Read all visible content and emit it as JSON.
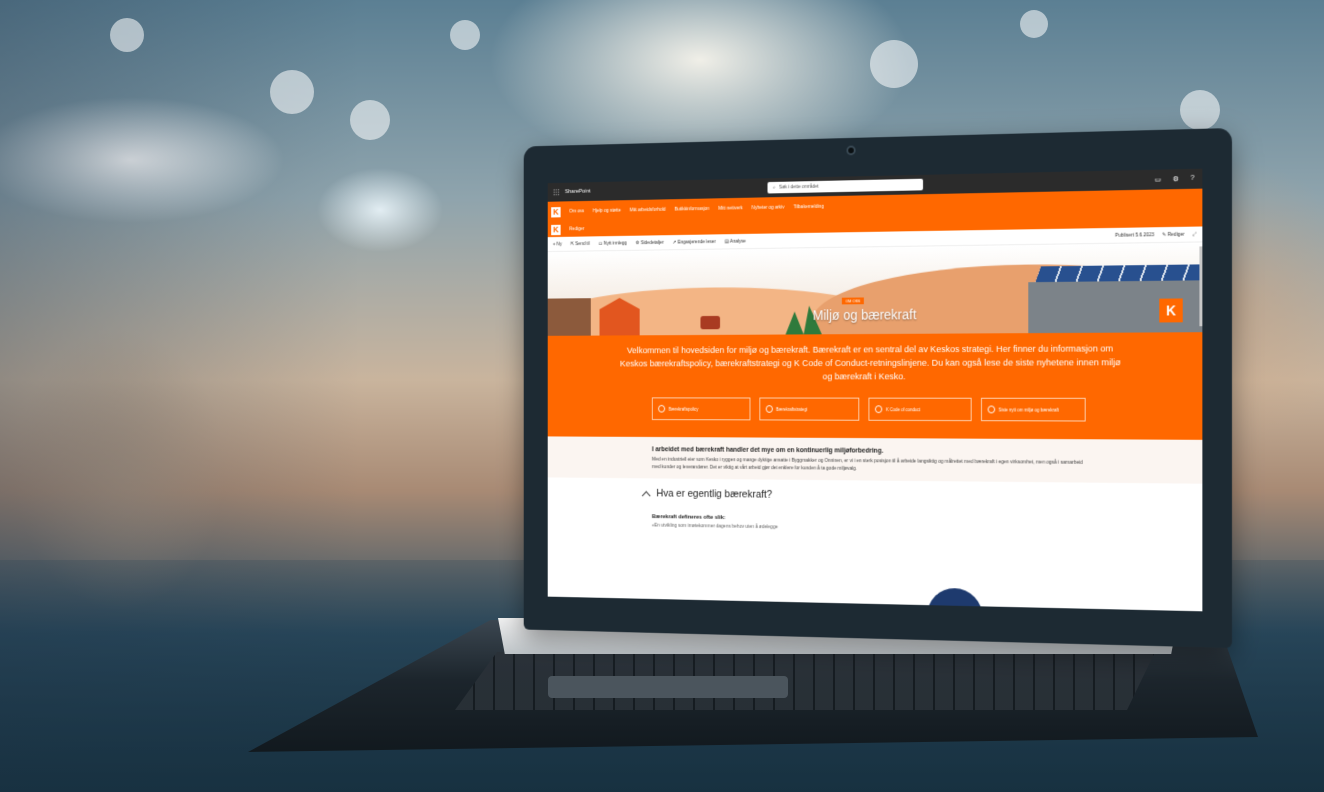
{
  "suite_bar": {
    "app_name": "SharePoint",
    "search_placeholder": "Søk i dette området"
  },
  "hub_nav": {
    "items": [
      "Om oss",
      "Hjelp og støtte",
      "Mitt arbeidsforhold",
      "Butikkinformasjon",
      "Mitt nettverk",
      "Nyheter og arkiv",
      "Tilbakemelding"
    ]
  },
  "site_bar": {
    "edit_label": "Rediger",
    "published": "Publisert 5.6.2023",
    "page_edit": "Rediger"
  },
  "command_bar": {
    "new": "Ny",
    "send": "Send til",
    "new_page": "Nytt innlegg",
    "page_details": "Sidedetaljer",
    "engaging": "Engasjerende leser",
    "analytics": "Analyse"
  },
  "hero": {
    "tag": "OM OSS",
    "title": "Miljø og bærekraft"
  },
  "intro": {
    "text": "Velkommen til hovedsiden for miljø og bærekraft. Bærekraft er en sentral del av Keskos strategi. Her finner du informasjon om Keskos bærekraftspolicy, bærekraftstrategi og K Code of Conduct-retningslinjene. Du kan også lese de siste nyhetene innen miljø og bærekraft i Kesko.",
    "quick_links": [
      "Bærekraftspolicy",
      "Bærekraftstrategi",
      "K Code of conduct",
      "Siste nytt om miljø og bærekraft"
    ]
  },
  "body": {
    "heading": "I arbeidet med bærekraft handler det mye om en kontinuerlig miljøforbedring.",
    "text": "Med en industriell eier som Kesko i ryggen og mange dyktige ansatte i Byggmakker og Onninen, er vi i en sterk posisjon til å arbeide langsiktig og målrettet med bærekraft i egen virksomhet, men også i samarbeid med kunder og leverandører. Det er viktig at vårt arbeid gjør det enklere for kunden å ta gode miljøvalg."
  },
  "accordion": {
    "title": "Hva er egentlig bærekraft?",
    "def_heading": "Bærekraft defineres ofte slik:",
    "def_text": "«En utvikling som imøtekommer dagens behov uten å ødelegge"
  },
  "colors": {
    "kesko_orange": "#ff6800",
    "suite_bar": "#2b2b2b"
  }
}
